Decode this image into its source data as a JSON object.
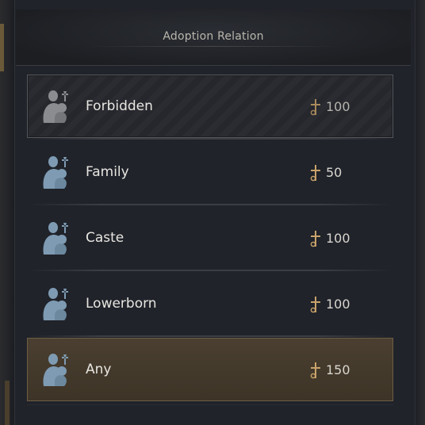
{
  "header": {
    "title": "Adoption Relation"
  },
  "colors": {
    "icon_available": "#7e9bb3",
    "icon_forbidden": "#8a8c90",
    "selected_bg": "#4a3f30",
    "cost_icon": "#c9a26a"
  },
  "options": [
    {
      "label": "Forbidden",
      "cost": "100",
      "state": "forbidden",
      "icon": "family-adoption-icon"
    },
    {
      "label": "Family",
      "cost": "50",
      "state": "normal",
      "icon": "family-adoption-icon"
    },
    {
      "label": "Caste",
      "cost": "100",
      "state": "normal",
      "icon": "family-adoption-icon"
    },
    {
      "label": "Lowerborn",
      "cost": "100",
      "state": "normal",
      "icon": "family-adoption-icon"
    },
    {
      "label": "Any",
      "cost": "150",
      "state": "selected",
      "icon": "family-adoption-icon"
    }
  ],
  "cost_icon": "piety-ankh-icon"
}
